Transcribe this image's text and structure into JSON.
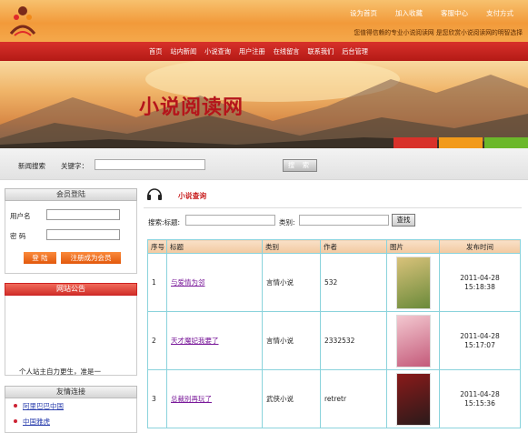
{
  "header": {
    "top_links": [
      "设为首页",
      "加入收藏",
      "客服中心",
      "支付方式"
    ],
    "slogan": "您值得信赖的专业小说阅读网 是您欣赏小说阅读网的明智选择"
  },
  "nav": {
    "items": [
      "首页",
      "站内新闻",
      "小说查询",
      "用户注册",
      "在线留言",
      "联系我们",
      "后台管理"
    ]
  },
  "banner": {
    "title": "小说阅读网",
    "tab_colors": [
      "#d8312a",
      "#f29a1a",
      "#6bb82a"
    ]
  },
  "news_search": {
    "label": "新闻搜索",
    "keyword_label": "关键字：",
    "keyword_value": "",
    "button": "搜 索"
  },
  "login": {
    "heading": "会员登陆",
    "username_label": "用户名",
    "username_value": "",
    "password_label": "密  码",
    "password_value": "",
    "login_button": "登 陆",
    "register_button": "注册成为会员"
  },
  "notice": {
    "heading": "网站公告",
    "text": "个人站主自力更生，准是一"
  },
  "friends": {
    "heading": "友情连接",
    "links": [
      "阿里巴巴中国",
      "中国雅虎"
    ]
  },
  "main": {
    "section_title": "小说查询",
    "filter": {
      "title_label": "搜索:标题:",
      "title_value": "",
      "category_label": "类别:",
      "category_value": "",
      "button": "查找"
    },
    "table": {
      "headers": [
        "序号",
        "标题",
        "类别",
        "作者",
        "图片",
        "发布时间"
      ],
      "rows": [
        {
          "no": "1",
          "title": "与爱情为邻",
          "category": "言情小说",
          "author": "532",
          "cover_colors": [
            "#d9c27a",
            "#6a8a3a"
          ],
          "date": "2011-04-28",
          "time": "15:18:38"
        },
        {
          "no": "2",
          "title": "天才魔妃我要了",
          "category": "言情小说",
          "author": "2332532",
          "cover_colors": [
            "#f3c8d0",
            "#c45a7a"
          ],
          "date": "2011-04-28",
          "time": "15:17:07"
        },
        {
          "no": "3",
          "title": "总裁别再玩了",
          "category": "武侠小说",
          "author": "retretr",
          "cover_colors": [
            "#8a1a1a",
            "#2a1a1a"
          ],
          "date": "2011-04-28",
          "time": "15:15:36"
        }
      ]
    }
  }
}
